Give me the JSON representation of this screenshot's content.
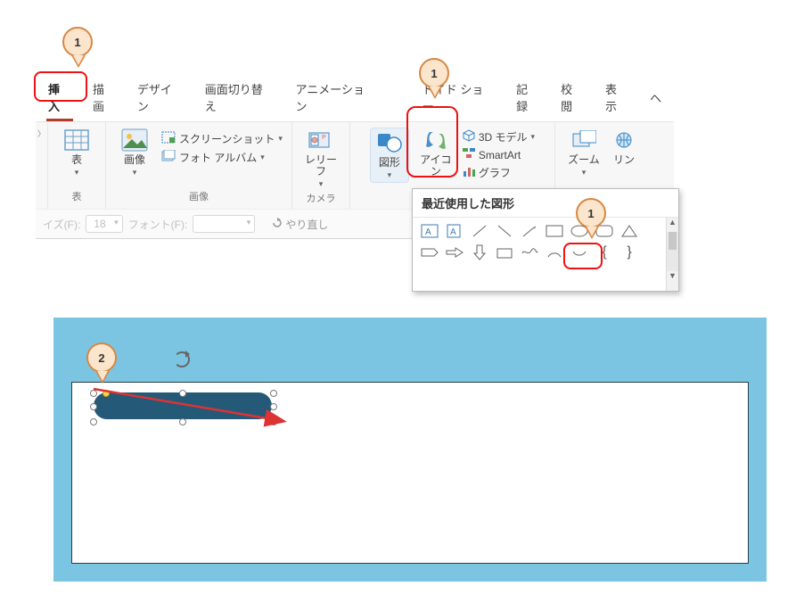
{
  "tabs": {
    "insert": "挿入",
    "draw": "描画",
    "design": "デザイン",
    "transition": "画面切り替え",
    "animation": "アニメーション",
    "slideshow_tail": "ドイド ショー",
    "record": "記録",
    "review": "校閲",
    "view": "表示",
    "he": "ヘ"
  },
  "ribbon": {
    "table": "表",
    "table_group": "表",
    "images": "画像",
    "screenshot": "スクリーンショット",
    "photo_album": "フォト アルバム",
    "images_group": "画像",
    "relief": "レリーフ",
    "camera_group": "カメラ",
    "shapes": "図形",
    "icons": "アイコン",
    "model3d": "3D モデル",
    "smartart": "SmartArt",
    "graph": "グラフ",
    "zoom": "ズーム",
    "link": "リン"
  },
  "dropdown": {
    "title": "最近使用した図形"
  },
  "qbar": {
    "size_label": "イズ(F):",
    "size_value": "18",
    "font_label": "フォント(F):",
    "undo": "やり直し"
  },
  "callouts": {
    "one": "1",
    "two": "2"
  }
}
